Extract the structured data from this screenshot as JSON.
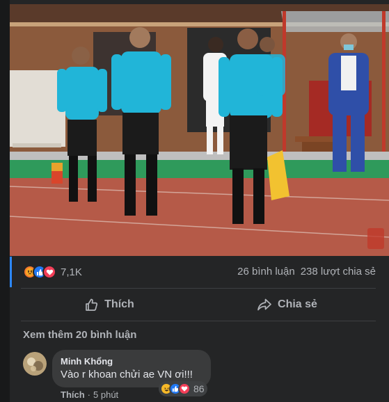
{
  "post": {
    "photo_alt": "Match officials walking onto pitch",
    "reactions": {
      "icons": [
        "angry-icon",
        "like-icon",
        "love-icon"
      ],
      "count": "7,1K"
    },
    "comments_count": "26 bình luận",
    "shares_count": "238 lượt chia sẻ",
    "actions": {
      "like_label": "Thích",
      "share_label": "Chia sẻ"
    },
    "see_more_comments": "Xem thêm 20 bình luận"
  },
  "comment": {
    "author": "Minh Khổng",
    "text": "Vào r khoan chửi ae VN ơi!!!",
    "reaction_count": "86",
    "like_label": "Thích",
    "separator": "·",
    "time": "5 phút"
  },
  "colors": {
    "background": "#18191a",
    "card": "#242526",
    "bubble": "#3a3b3c",
    "text_primary": "#e4e6eb",
    "text_secondary": "#b0b3b8",
    "accent": "#2d88ff",
    "referee_shirt": "#21b5d8"
  }
}
